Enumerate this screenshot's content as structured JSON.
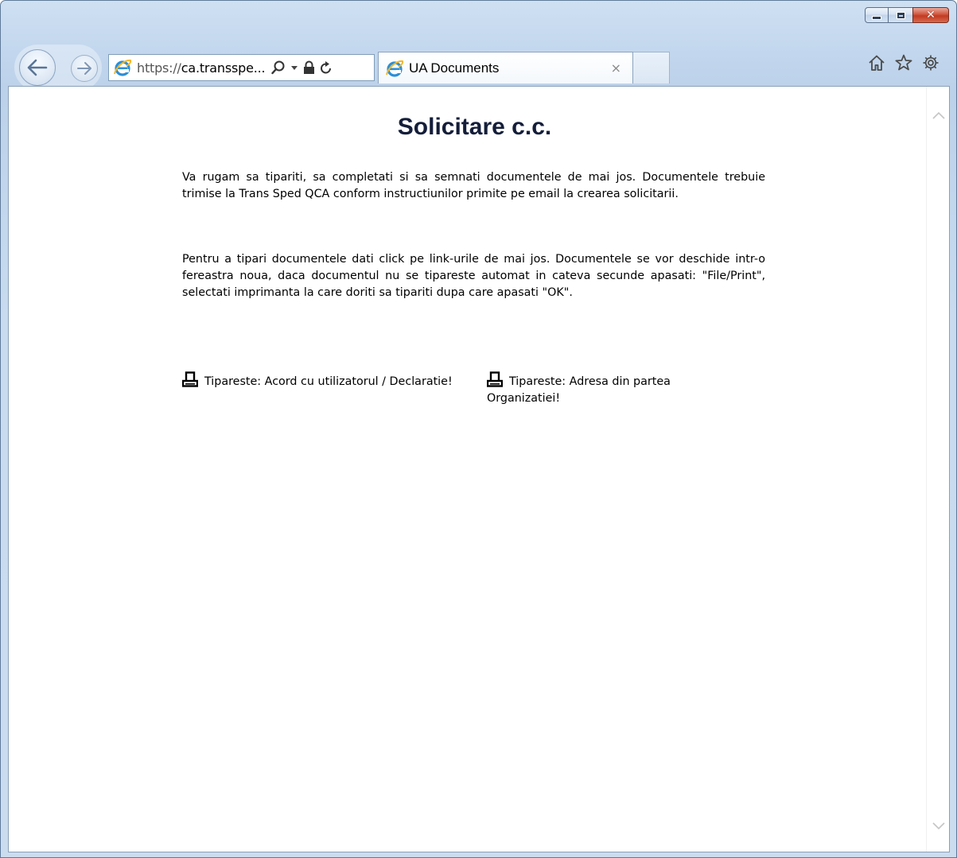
{
  "browser": {
    "address_url": "https://ca.transspe...",
    "address_scheme": "https://",
    "address_host": "ca.transspe...",
    "tab_title": "UA Documents",
    "tab_close": "×",
    "caption_close": "✕"
  },
  "page": {
    "title": "Solicitare c.c.",
    "paragraph1": "Va rugam sa tipariti, sa completati si sa semnati documentele de mai jos. Documentele trebuie trimise la Trans Sped QCA conform instructiunilor primite pe email la crearea solicitarii.",
    "paragraph2": "Pentru a tipari documentele dati click pe link-urile de mai jos. Documentele se vor deschide intr-o fereastra noua, daca documentul nu se tipareste automat in cateva secunde apasati: \"File/Print\", selectati imprimanta la care doriti sa tipariti dupa care apasati \"OK\".",
    "links": [
      {
        "label": "Tipareste: Acord cu utilizatorul / Declaratie!",
        "icon": "printer-icon"
      },
      {
        "label": "Tipareste: Adresa din partea Organizatiei!",
        "icon": "printer-icon"
      }
    ]
  },
  "icons": {
    "back": "back-arrow-icon",
    "forward": "forward-arrow-icon",
    "ie_logo": "ie-logo-icon",
    "search": "search-icon",
    "dropdown": "dropdown-arrow-icon",
    "lock": "lock-icon",
    "refresh": "refresh-icon",
    "home": "home-icon",
    "favorites": "star-icon",
    "tools": "gear-icon"
  },
  "colors": {
    "title_color": "#141e3a",
    "close_button": "#c23a20",
    "window_frame": "#c3d7ee"
  }
}
